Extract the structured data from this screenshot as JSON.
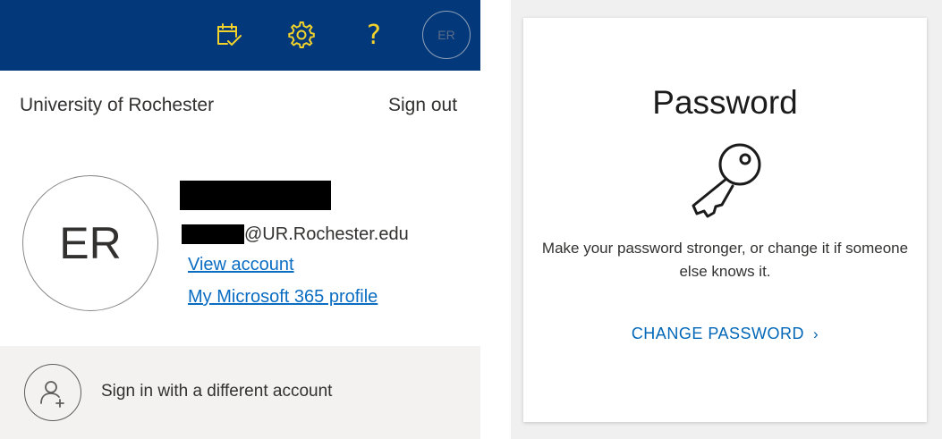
{
  "account_panel": {
    "header": {
      "icons": {
        "calendar": "calendar-check-icon",
        "settings": "gear-icon",
        "help": "?",
        "avatar": "avatar-icon"
      },
      "avatar_initials": "ER"
    },
    "org_name": "University of Rochester",
    "sign_out_label": "Sign out",
    "avatar_initials": "ER",
    "email_domain": "@UR.Rochester.edu",
    "view_account_label": "View account",
    "profile_label": "My Microsoft 365 profile",
    "switch_account_label": "Sign in with a different account"
  },
  "password_card": {
    "title": "Password",
    "icon": "key-icon",
    "description": "Make your password stronger, or change it if someone else knows it.",
    "action_label": "CHANGE PASSWORD",
    "action_chevron": "›"
  },
  "colors": {
    "header_bg": "#03397a",
    "header_icon": "#f2d22b",
    "link": "#0a6dc2",
    "card_action": "#0067b8"
  }
}
